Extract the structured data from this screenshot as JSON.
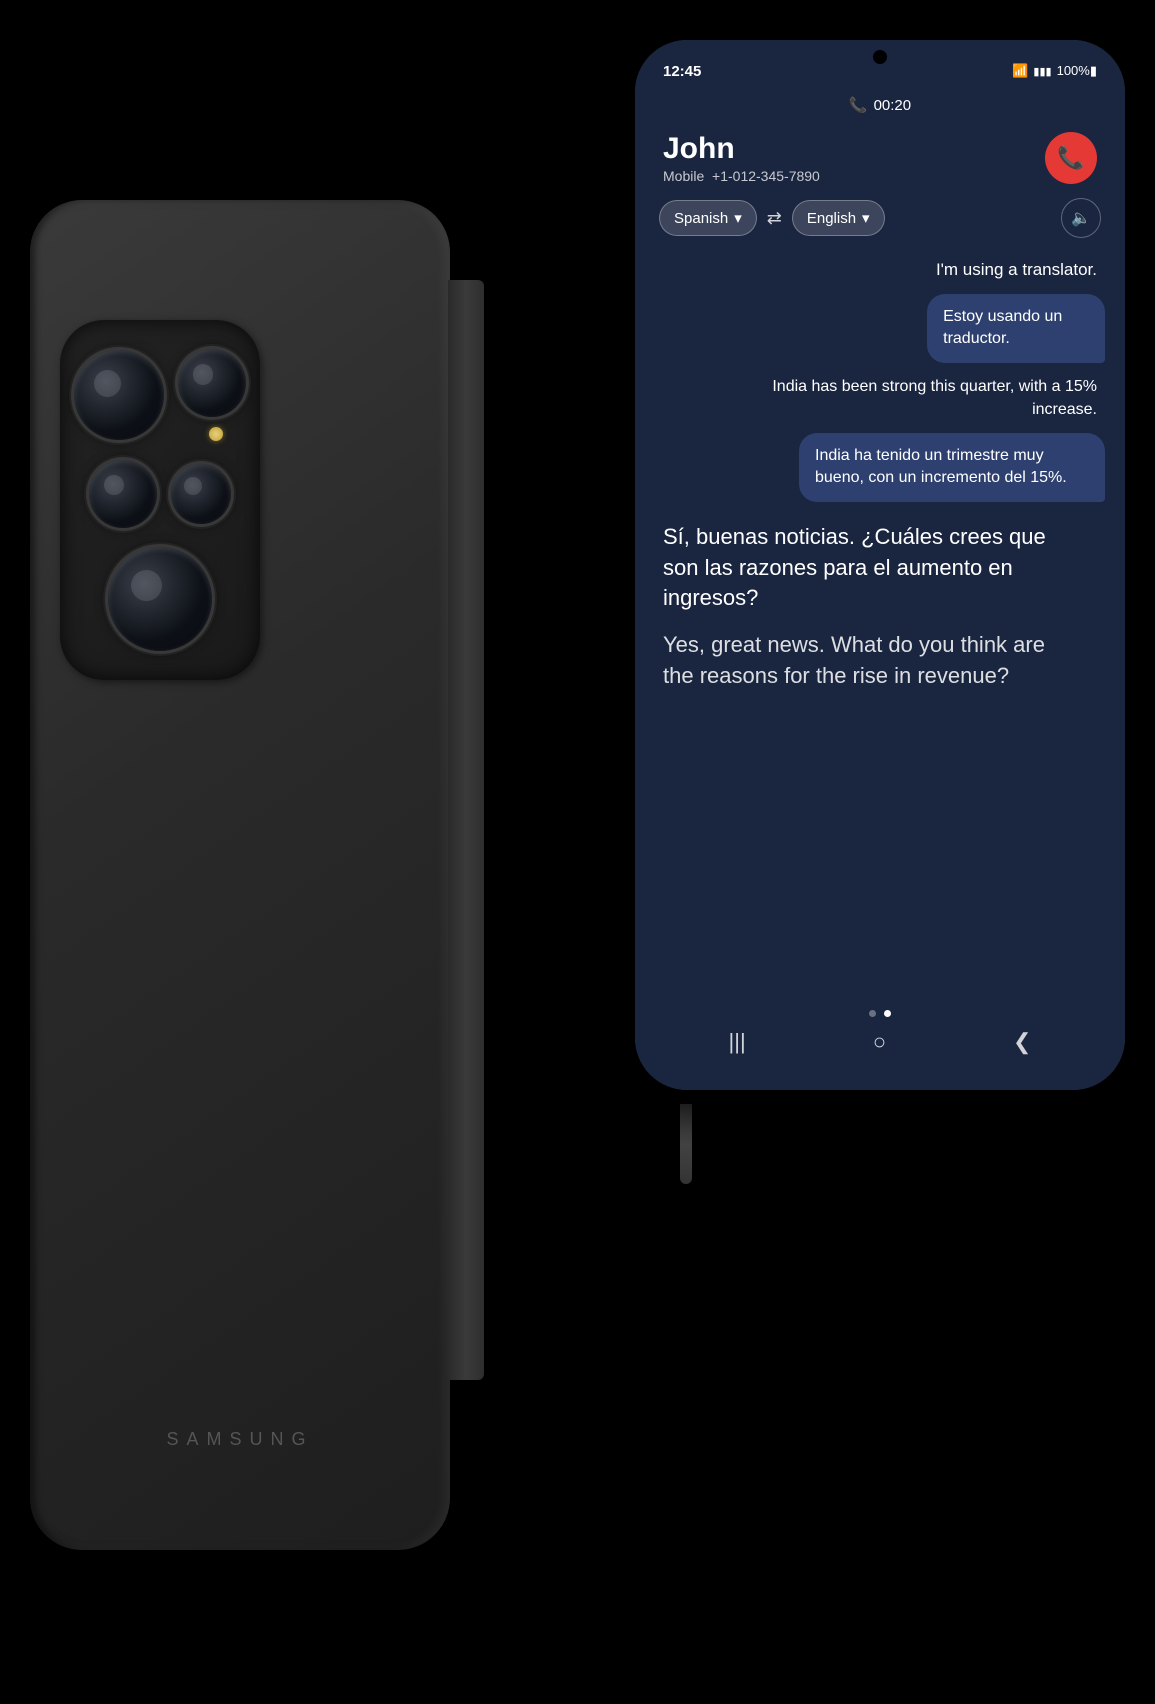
{
  "scene": {
    "background": "#000000"
  },
  "back_phone": {
    "brand": "SAMSUNG",
    "camera_lenses": [
      "main",
      "telephoto",
      "ultrawide",
      "periscope"
    ],
    "color": "#2a2a2a"
  },
  "front_phone": {
    "status_bar": {
      "time": "12:45",
      "battery": "100%",
      "signal": "WiFi + 4G"
    },
    "call": {
      "duration": "00:20",
      "caller_name": "John",
      "caller_label": "Mobile",
      "caller_number": "+1-012-345-7890",
      "end_call_label": "✆"
    },
    "language_bar": {
      "source_lang": "Spanish",
      "target_lang": "English",
      "swap_label": "⇄",
      "speaker_label": "🔊"
    },
    "messages": [
      {
        "id": 1,
        "side": "right",
        "type": "normal",
        "text": "I'm using a translator."
      },
      {
        "id": 2,
        "side": "right",
        "type": "translated",
        "text": "Estoy usando un traductor."
      },
      {
        "id": 3,
        "side": "right",
        "type": "normal",
        "text": "India has been strong this quarter, with a 15% increase."
      },
      {
        "id": 4,
        "side": "right",
        "type": "translated",
        "text": "India ha tenido un trimestre muy bueno, con un incremento del 15%."
      },
      {
        "id": 5,
        "side": "left",
        "type": "large",
        "text": "Sí, buenas noticias. ¿Cuáles crees que son las razones para el aumento en ingresos?"
      },
      {
        "id": 6,
        "side": "left",
        "type": "large-translated",
        "text": "Yes, great news. What do you think are the reasons for the rise in revenue?"
      }
    ],
    "nav": {
      "dots": [
        "inactive",
        "active"
      ],
      "back_btn": "❮",
      "home_btn": "○",
      "recents_btn": "|||"
    }
  }
}
